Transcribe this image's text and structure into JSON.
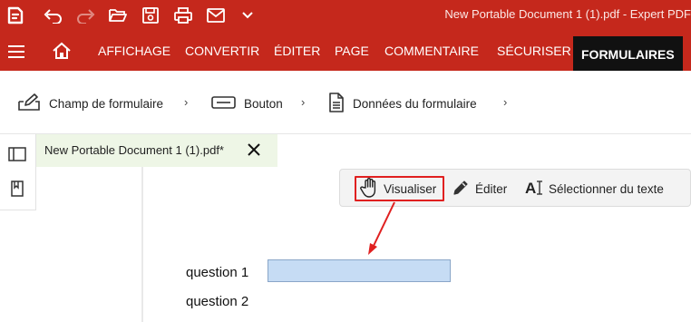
{
  "titlebar": {
    "title": "New Portable Document 1 (1).pdf   -   Expert PDF",
    "icons": [
      "app-logo-icon",
      "undo-icon",
      "redo-icon",
      "open-folder-icon",
      "save-icon",
      "print-icon",
      "email-icon",
      "chevron-down-icon"
    ]
  },
  "menu": {
    "tabs": [
      "AFFICHAGE",
      "CONVERTIR",
      "ÉDITER",
      "PAGE",
      "COMMENTAIRE",
      "SÉCURISER",
      "FORMULAIRES"
    ],
    "active_tab": "FORMULAIRES"
  },
  "ribbon": {
    "items": [
      {
        "label": "Champ de formulaire",
        "icon": "form-field-icon"
      },
      {
        "label": "Bouton",
        "icon": "button-icon"
      },
      {
        "label": "Données du formulaire",
        "icon": "form-data-icon"
      }
    ],
    "chevron": "›"
  },
  "document": {
    "tab_name": "New Portable Document 1 (1).pdf*",
    "close_glyph": "✕"
  },
  "floating_toolbar": {
    "view_label": "Visualiser",
    "edit_label": "Éditer",
    "select_text_label": "Sélectionner du texte",
    "select_text_glyph": "A"
  },
  "form": {
    "question1": "question 1",
    "question2": "question 2"
  },
  "colors": {
    "brand_red": "#c5281c",
    "active_tab_bg": "#111111",
    "doc_tab_bg": "#eef6e6",
    "highlight_border": "#e02020",
    "field_fill": "#c6dcf4"
  }
}
